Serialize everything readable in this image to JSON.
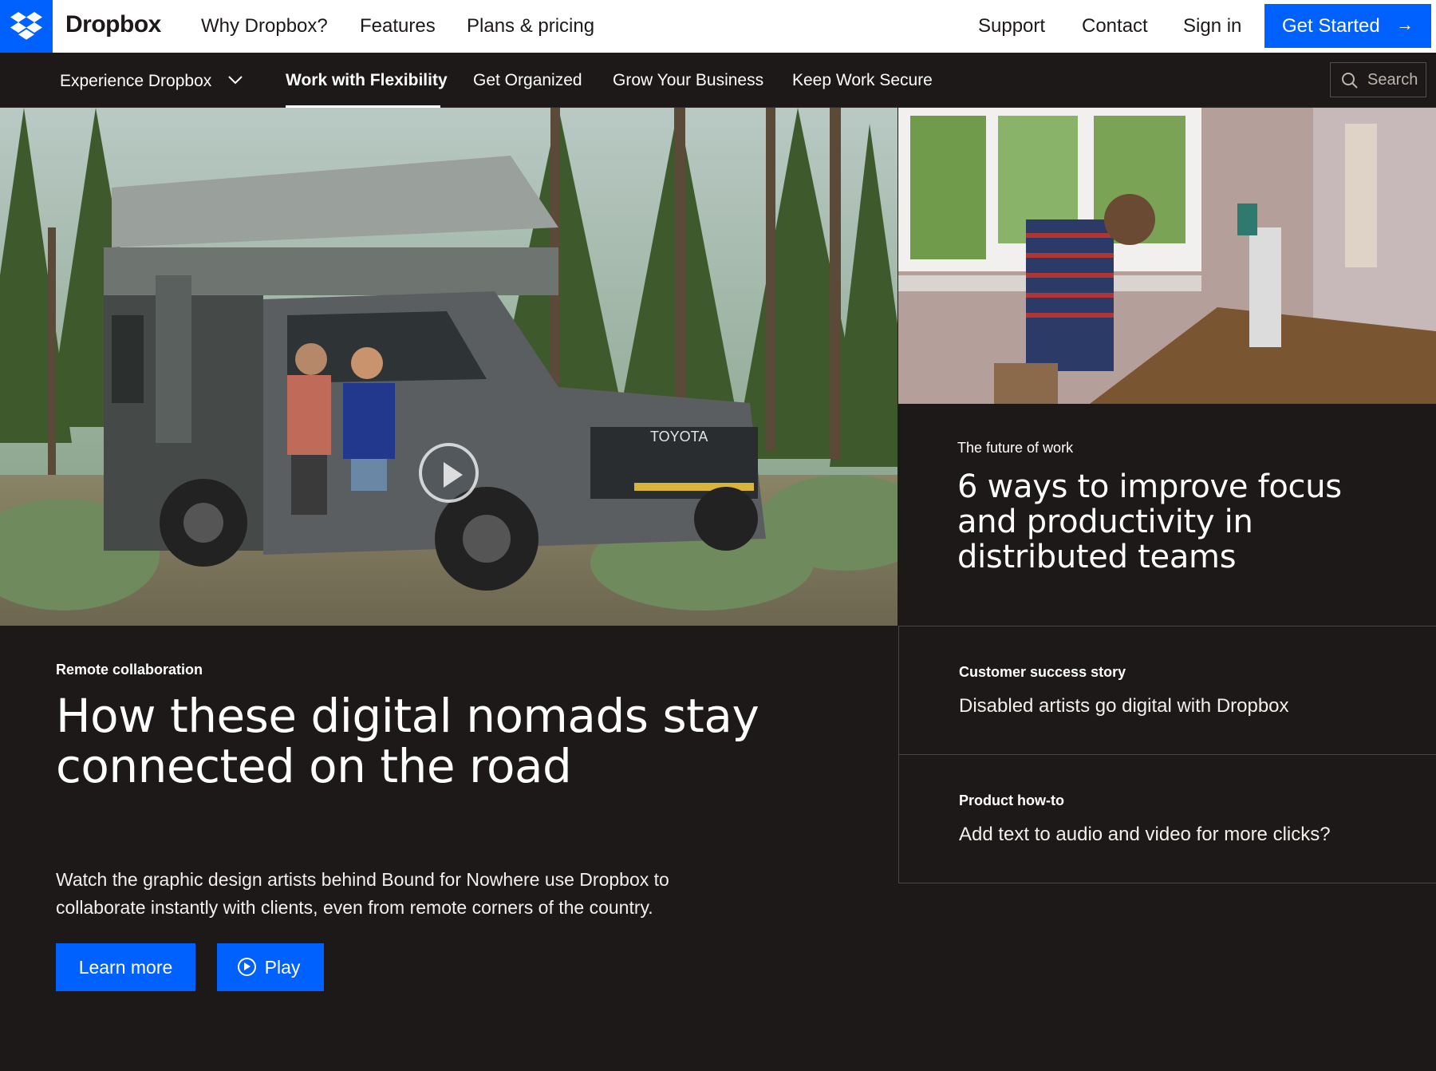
{
  "topnav": {
    "brand": "Dropbox",
    "items": [
      "Why Dropbox?",
      "Features",
      "Plans & pricing"
    ],
    "right_items": [
      "Support",
      "Contact",
      "Sign in"
    ],
    "cta_label": "Get Started",
    "cta_icon": "arrow-right-icon"
  },
  "subnav": {
    "experience_label": "Experience Dropbox",
    "tabs": [
      "Work with Flexibility",
      "Get Organized",
      "Grow Your Business",
      "Keep Work Secure"
    ],
    "active_tab": "Work with Flexibility",
    "search_placeholder": "Search"
  },
  "hero": {
    "eyebrow": "Remote collaboration",
    "title": "How these digital nomads stay connected on the road",
    "description": "Watch the graphic design artists behind Bound for Nowhere use Dropbox to collaborate instantly with clients, even from remote corners of the country.",
    "learn_more_label": "Learn more",
    "play_label": "Play",
    "truck_badge": "TOYOTA"
  },
  "feature": {
    "eyebrow": "The future of work",
    "title": "6 ways to improve focus and productivity in distributed teams"
  },
  "cards": [
    {
      "label": "Customer success story",
      "text": "Disabled artists go digital with Dropbox"
    },
    {
      "label": "Product how-to",
      "text": "Add text to audio and video for more clicks?"
    }
  ],
  "colors": {
    "accent": "#0061fe",
    "background": "#1e1919",
    "text": "#ffffff"
  }
}
